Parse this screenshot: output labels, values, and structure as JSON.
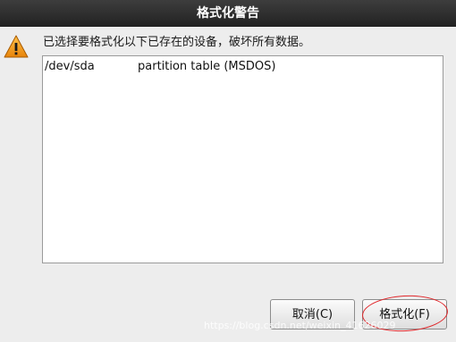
{
  "window": {
    "title": "格式化警告"
  },
  "icons": {
    "warning": "warning-icon"
  },
  "message": "已选择要格式化以下已存在的设备，破坏所有数据。",
  "devices": [
    {
      "name": "/dev/sda",
      "description": "partition table (MSDOS)"
    }
  ],
  "buttons": {
    "cancel_label": "取消(C)",
    "format_label": "格式化(F)"
  },
  "watermark": "https://blog.csdn.net/weixin_41626029",
  "colors": {
    "titlebar": "#2d2d2d",
    "warning": "#f0a020",
    "highlight": "#e0262a"
  }
}
